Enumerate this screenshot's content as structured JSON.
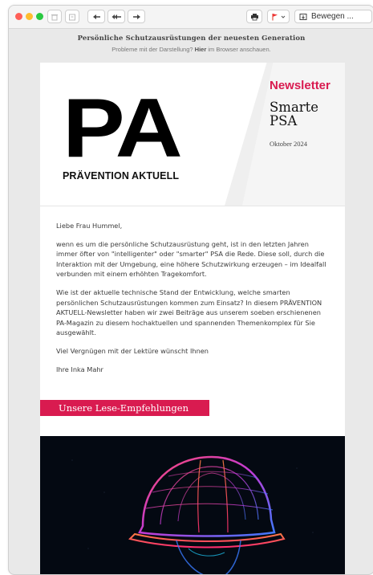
{
  "toolbar": {
    "move_label": "Bewegen ..."
  },
  "email": {
    "preheader": "Persönliche Schutzausrüstungen der neuesten Generation",
    "browser_prefix": "Probleme mit der Darstellung? ",
    "browser_link": "Hier",
    "browser_suffix": " im Browser anschauen."
  },
  "hero": {
    "logo_big": "PA",
    "logo_sub": "PRÄVENTION AKTUELL",
    "label": "Newsletter",
    "title": "Smarte PSA",
    "date": "Oktober 2024"
  },
  "body": {
    "greeting": "Liebe Frau Hummel,",
    "paragraph1": "wenn es um die persönliche Schutzausrüstung geht, ist in den letzten Jahren immer öfter von \"intelligenter\" oder \"smarter\" PSA die Rede. Diese soll, durch die Interaktion mit der Umgebung, eine höhere Schutzwirkung erzeugen – im Idealfall verbunden mit einem erhöhten Tragekomfort.",
    "paragraph2": "Wie ist der aktuelle technische Stand der Entwicklung, welche smarten persönlichen Schutzausrüstungen kommen zum Einsatz? In diesem PRÄVENTION AKTUELL-Newsletter haben wir zwei Beiträge aus unserem soeben erschienenen PA-Magazin zu diesem hochaktuellen und spannenden Themenkomplex für Sie ausgewählt.",
    "closing": "Viel Vergnügen mit der Lektüre wünscht Ihnen",
    "signature": "Ihre Inka Mahr"
  },
  "section": {
    "heading": "Unsere Lese-Empfehlungen"
  },
  "colors": {
    "accent": "#d91b50",
    "window_bg": "#e9e9e9"
  }
}
